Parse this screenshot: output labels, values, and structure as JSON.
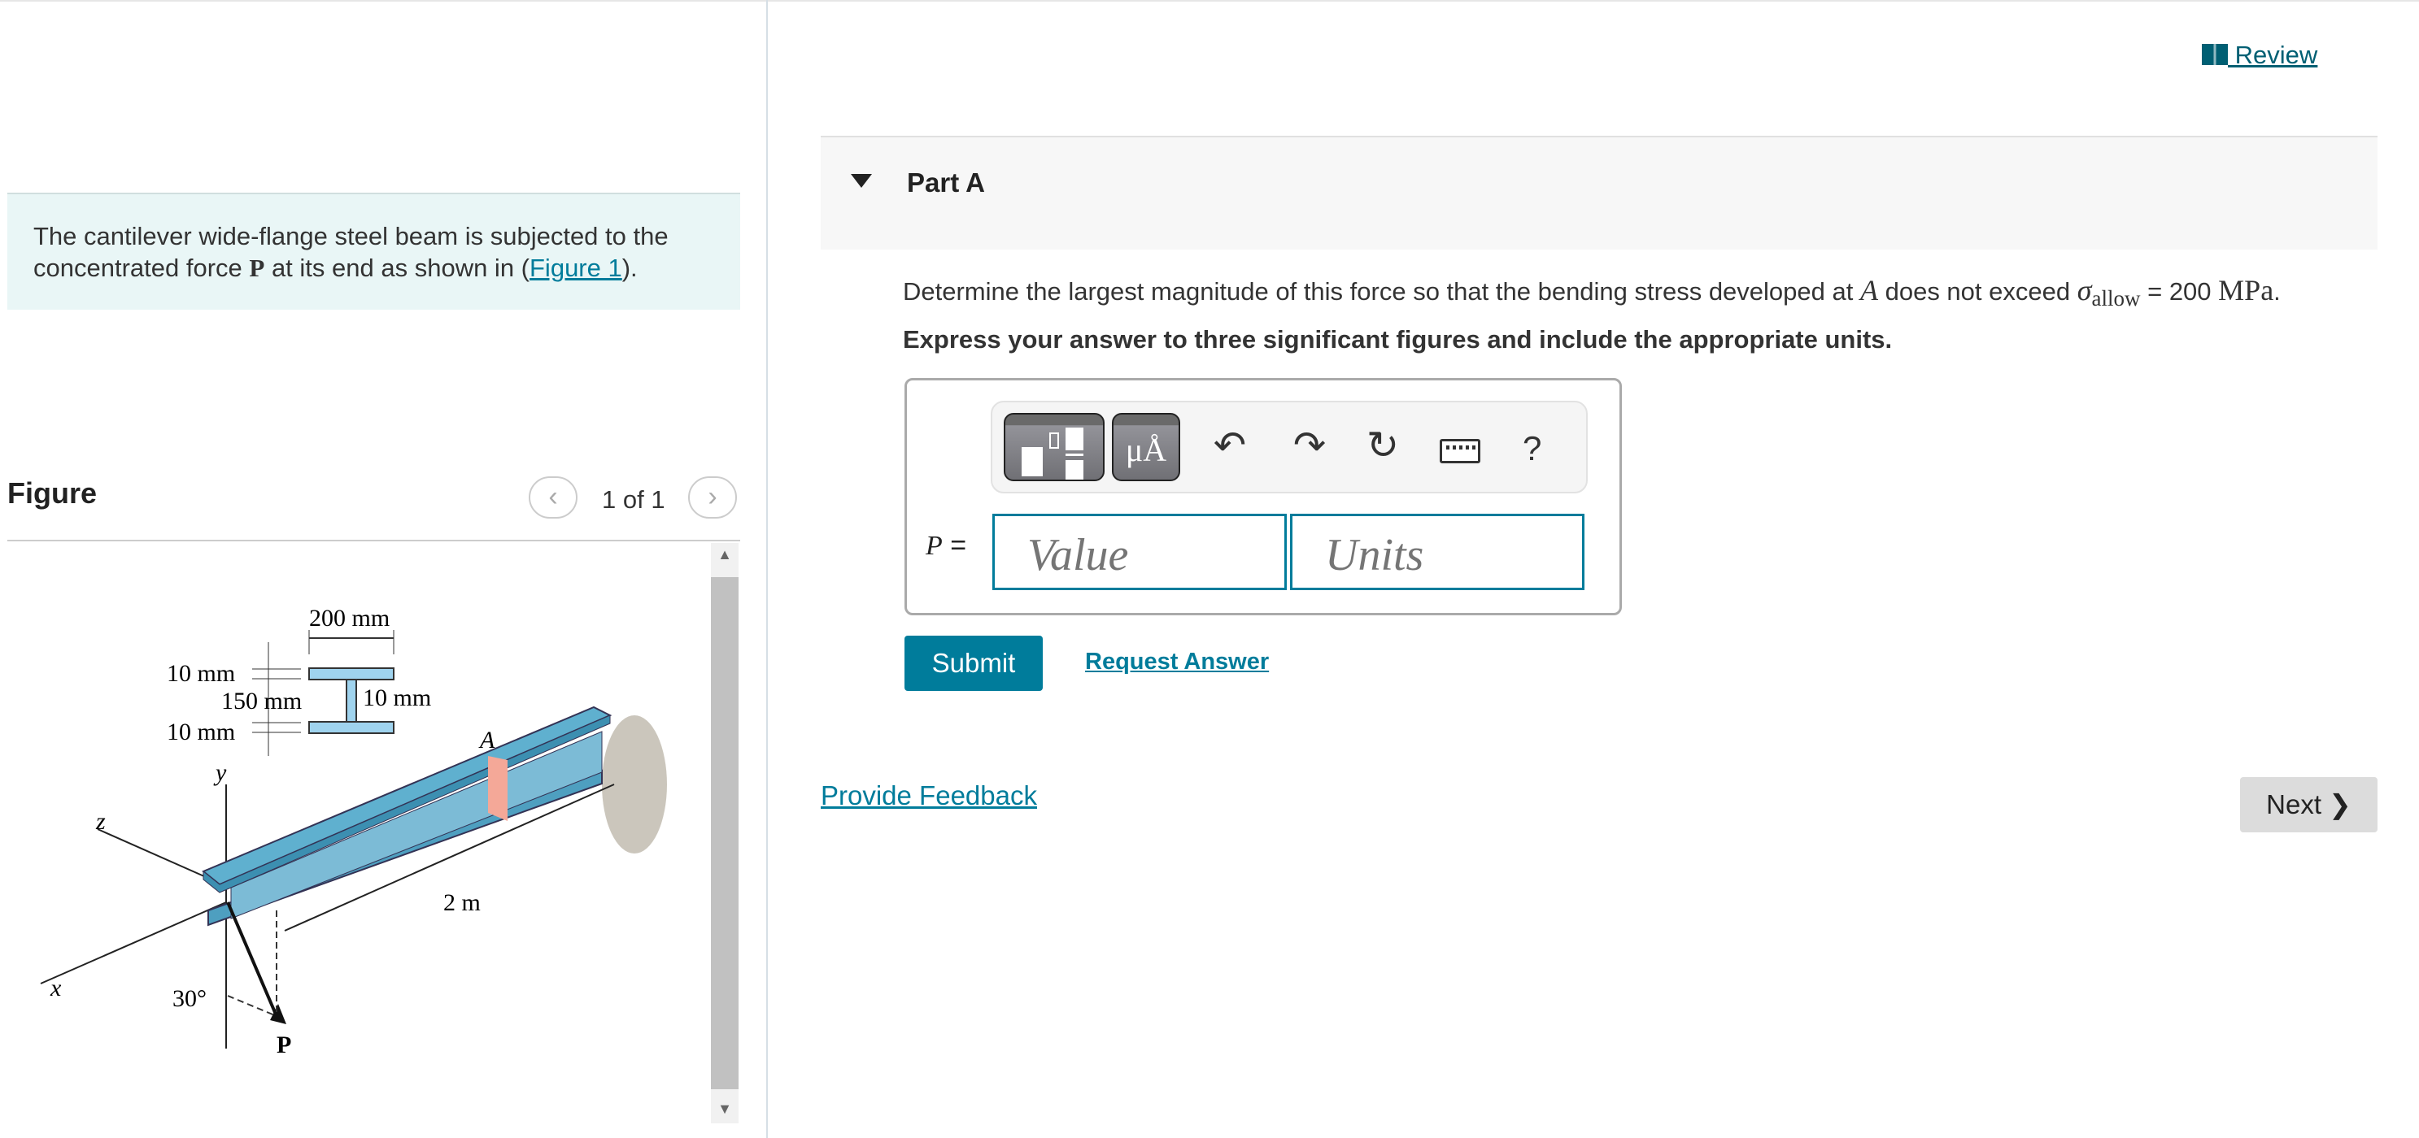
{
  "intro": {
    "text_before": "The cantilever wide-flange steel beam is subjected to the concentrated force ",
    "force_symbol": "P",
    "text_middle": " at its end as shown in (",
    "figure_link": "Figure 1",
    "text_after": ")."
  },
  "figure": {
    "title": "Figure",
    "pager": "1 of 1",
    "prev_icon": "chevron-left",
    "next_icon": "chevron-right",
    "labels": {
      "top_width": "200 mm",
      "flange_top": "10 mm",
      "web_height": "150 mm",
      "web_thickness": "10 mm",
      "flange_bottom": "10 mm",
      "y": "y",
      "z": "z",
      "x": "x",
      "point": "A",
      "length": "2 m",
      "angle": "30°",
      "force": "P"
    },
    "colors": {
      "beam": "#5fb0cf",
      "section": "#9fd3ee",
      "cut": "#f4a898"
    }
  },
  "review": {
    "label": " Review",
    "icon": "book-icon"
  },
  "part": {
    "label": "Part A",
    "question_before": "Determine the largest magnitude of this force so that the bending stress developed at ",
    "point": "A",
    "question_middle": " does not exceed ",
    "sigma": "σ",
    "sub": "allow",
    "question_after": " = 200 ",
    "unit": "MPa",
    "question_end": ".",
    "instruction": "Express your answer to three significant figures and include the appropriate units."
  },
  "answer": {
    "label_var": "P",
    "label_eq": " =",
    "value_placeholder": "Value",
    "units_placeholder": "Units",
    "help": "?",
    "units_btn": "μÅ"
  },
  "buttons": {
    "submit": "Submit",
    "request_answer": "Request Answer",
    "provide_feedback": "Provide Feedback",
    "next": "Next ❯"
  },
  "colors": {
    "accent": "#007c9b",
    "link_dark": "#005f73"
  }
}
